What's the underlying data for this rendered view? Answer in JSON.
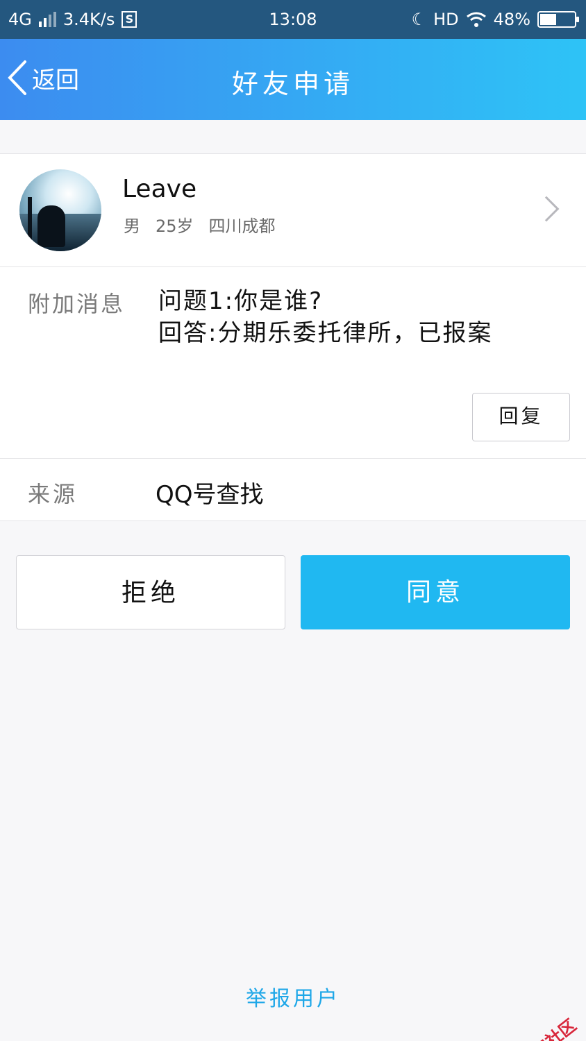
{
  "status_bar": {
    "network": "4G",
    "speed": "3.4K/s",
    "sim_label": "S",
    "time": "13:08",
    "hd": "HD",
    "battery": "48%",
    "battery_level": 0.48
  },
  "nav": {
    "back_label": "返回",
    "title": "好友申请"
  },
  "profile": {
    "name": "Leave",
    "gender": "男",
    "age": "25岁",
    "location": "四川成都"
  },
  "message": {
    "label": "附加消息",
    "question": "问题1:你是谁?",
    "answer": "回答:分期乐委托律所，已报案",
    "reply_button": "回复"
  },
  "source": {
    "label": "来源",
    "value": "QQ号查找"
  },
  "actions": {
    "reject": "拒绝",
    "accept": "同意"
  },
  "footer": {
    "report": "举报用户"
  },
  "watermark": "卡农社区",
  "colors": {
    "accent": "#20b8f1",
    "nav_gradient_start": "#3c8cf0",
    "nav_gradient_end": "#2ec3f6",
    "statusbar": "#24577f"
  }
}
